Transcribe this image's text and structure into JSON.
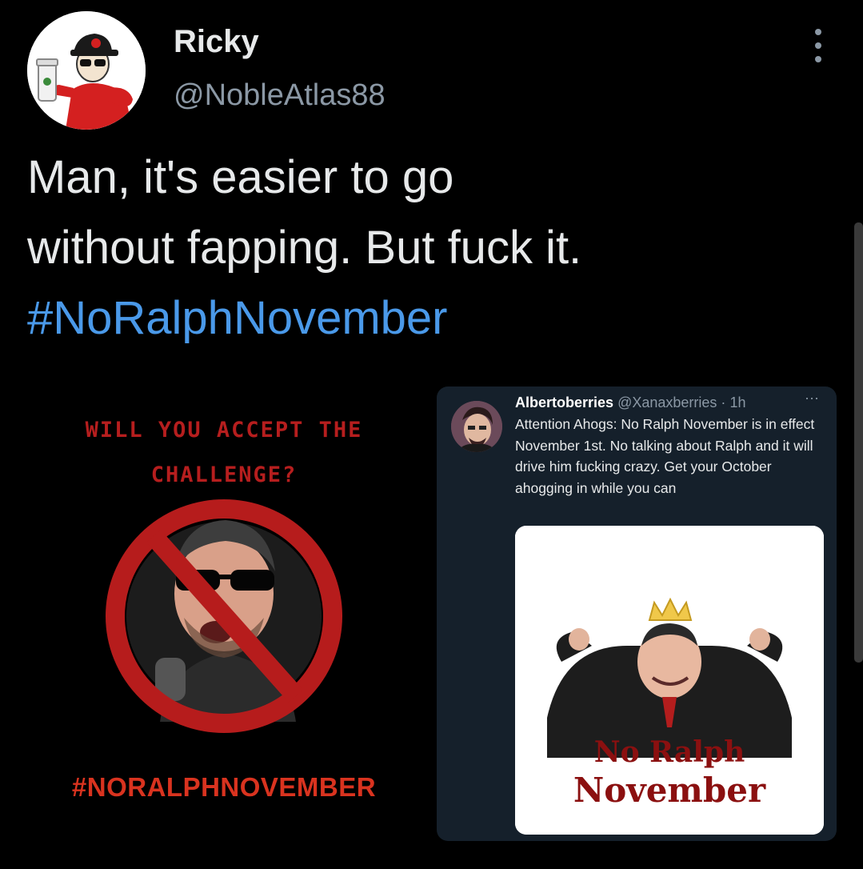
{
  "tweet": {
    "display_name": "Ricky",
    "handle": "@NobleAtlas88",
    "text_line1": "Man, it's easier to go",
    "text_line2": "without fapping. But fuck it.",
    "hashtag": "#NoRalphNovember"
  },
  "left_image": {
    "line1": "WILL YOU ACCEPT THE",
    "line2": "CHALLENGE?",
    "hashtag": "#NORALPHNOVEMBER"
  },
  "quoted_tweet": {
    "display_name": "Albertoberries",
    "handle": "@Xanaxberries",
    "separator": "·",
    "time": "1h",
    "more": "···",
    "text": "Attention Ahogs: No Ralph November is in effect November 1st. No talking about Ralph and it will drive him fucking crazy. Get your October ahogging in while you can",
    "media_line1": "No Ralph",
    "media_line2": "November"
  },
  "colors": {
    "background": "#000000",
    "hashtag_blue": "#4a99e9",
    "challenge_red": "#b61e1e",
    "quoted_bg": "#15202b"
  },
  "icons": [
    "more-vertical-icon",
    "more-horizontal-icon",
    "no-symbol-icon"
  ]
}
